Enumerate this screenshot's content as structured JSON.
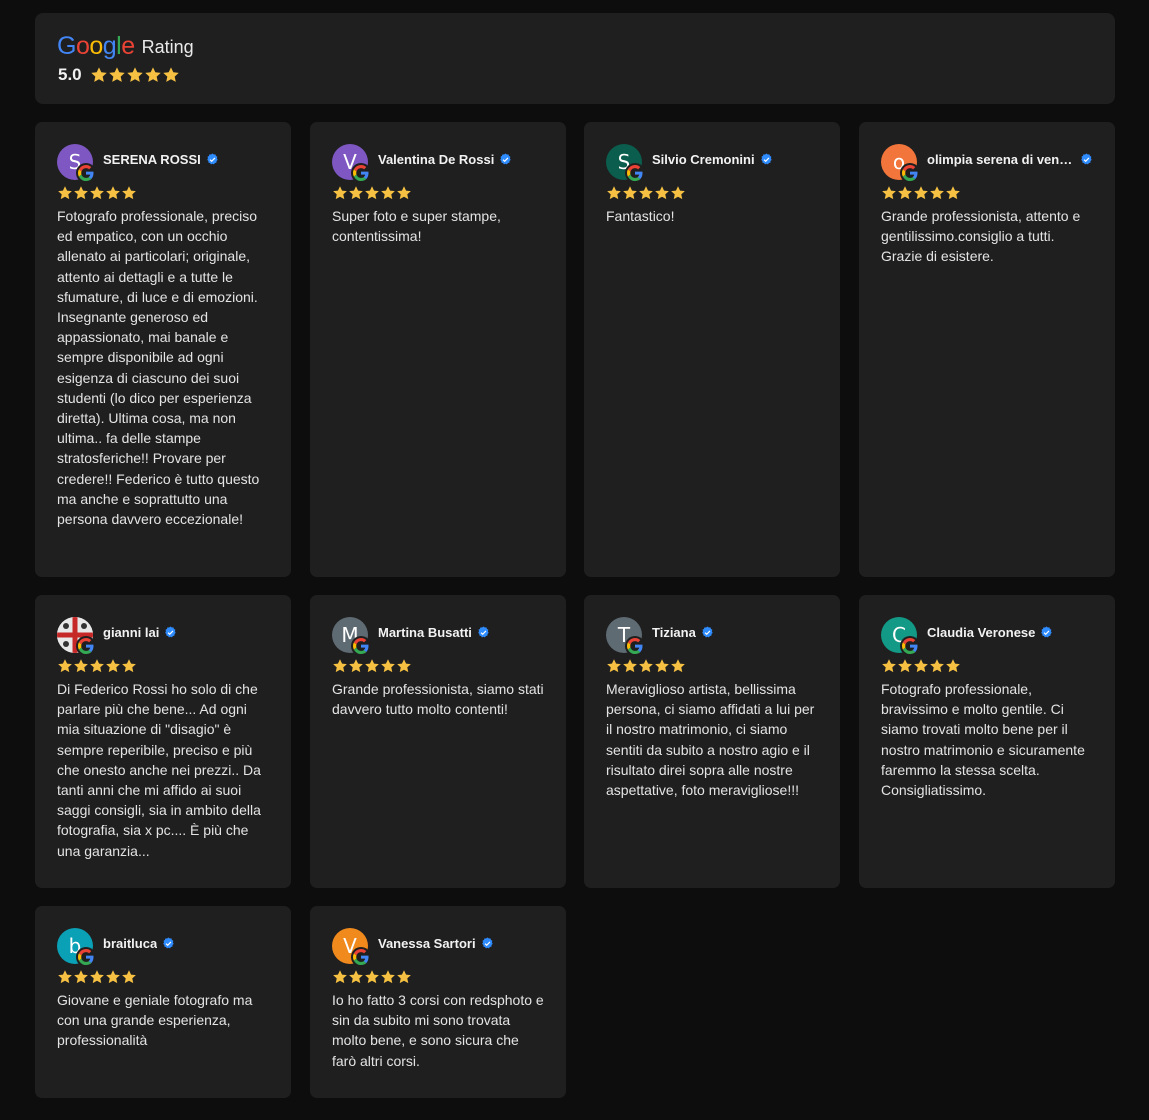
{
  "header": {
    "logo_text": "Google",
    "rating_label": "Rating",
    "score": "5.0",
    "stars": 5
  },
  "colors": {
    "star": "#f6c143",
    "verified": "#2f8cff",
    "card_bg": "#1f1f1f",
    "page_bg": "#0d0d0d"
  },
  "reviews": [
    {
      "name": "SERENA ROSSI",
      "initial": "S",
      "avatar_color": "#7e57c2",
      "stars": 5,
      "text": "Fotografo professionale, preciso ed empatico, con un occhio allenato ai particolari; originale, attento ai dettagli e a tutte le sfumature, di luce e di emozioni. Insegnante generoso ed appassionato, mai banale e sempre disponibile ad ogni esigenza di ciascuno dei suoi studenti (lo dico per esperienza diretta). Ultima cosa, ma non ultima.. fa delle stampe stratosferiche!! Provare per credere!! Federico è tutto questo ma anche e soprattutto una persona davvero eccezionale!"
    },
    {
      "name": "Valentina De Rossi",
      "initial": "V",
      "avatar_color": "#7e57c2",
      "stars": 5,
      "text": "Super foto e super stampe, contentissima!"
    },
    {
      "name": "Silvio Cremonini",
      "initial": "S",
      "avatar_color": "#0b5e4e",
      "stars": 5,
      "text": "Fantastico!"
    },
    {
      "name": "olimpia serena di veno...",
      "initial": "o",
      "avatar_color": "#f2763b",
      "stars": 5,
      "text": "Grande professionista, attento e gentilissimo.consiglio a tutti. Grazie di esistere."
    },
    {
      "name": "gianni lai",
      "initial": "",
      "avatar_color": "#d9d9d9",
      "stars": 5,
      "text": "Di Federico Rossi ho solo di che parlare più che bene... Ad ogni mia situazione di \"disagio\" è sempre reperibile, preciso e più che onesto anche nei prezzi.. Da tanti anni che mi affido ai suoi saggi consigli, sia in ambito della fotografia, sia x pc.... È più che una garanzia..."
    },
    {
      "name": "Martina Busatti",
      "initial": "M",
      "avatar_color": "#5f6b73",
      "stars": 5,
      "text": "Grande professionista, siamo stati davvero tutto molto contenti!"
    },
    {
      "name": "Tiziana",
      "initial": "T",
      "avatar_color": "#5f6b73",
      "stars": 5,
      "text": "Meraviglioso artista, bellissima persona, ci siamo affidati a lui per il nostro matrimonio, ci siamo sentiti da subito a nostro agio e il risultato direi sopra alle nostre aspettative, foto meravigliose!!!"
    },
    {
      "name": "Claudia Veronese",
      "initial": "C",
      "avatar_color": "#139a86",
      "stars": 5,
      "text": "Fotografo professionale, bravissimo e molto gentile. Ci siamo trovati molto bene per il nostro matrimonio e sicuramente faremmo la stessa scelta. Consigliatissimo."
    },
    {
      "name": "braitluca",
      "initial": "b",
      "avatar_color": "#0aa0b5",
      "stars": 5,
      "text": "Giovane e geniale fotografo ma con una grande esperienza, professionalità"
    },
    {
      "name": "Vanessa Sartori",
      "initial": "V",
      "avatar_color": "#f08a1d",
      "stars": 5,
      "text": "Io ho fatto 3 corsi con redsphoto e sin da subito mi sono trovata molto bene, e sono sicura che farò altri corsi."
    }
  ]
}
